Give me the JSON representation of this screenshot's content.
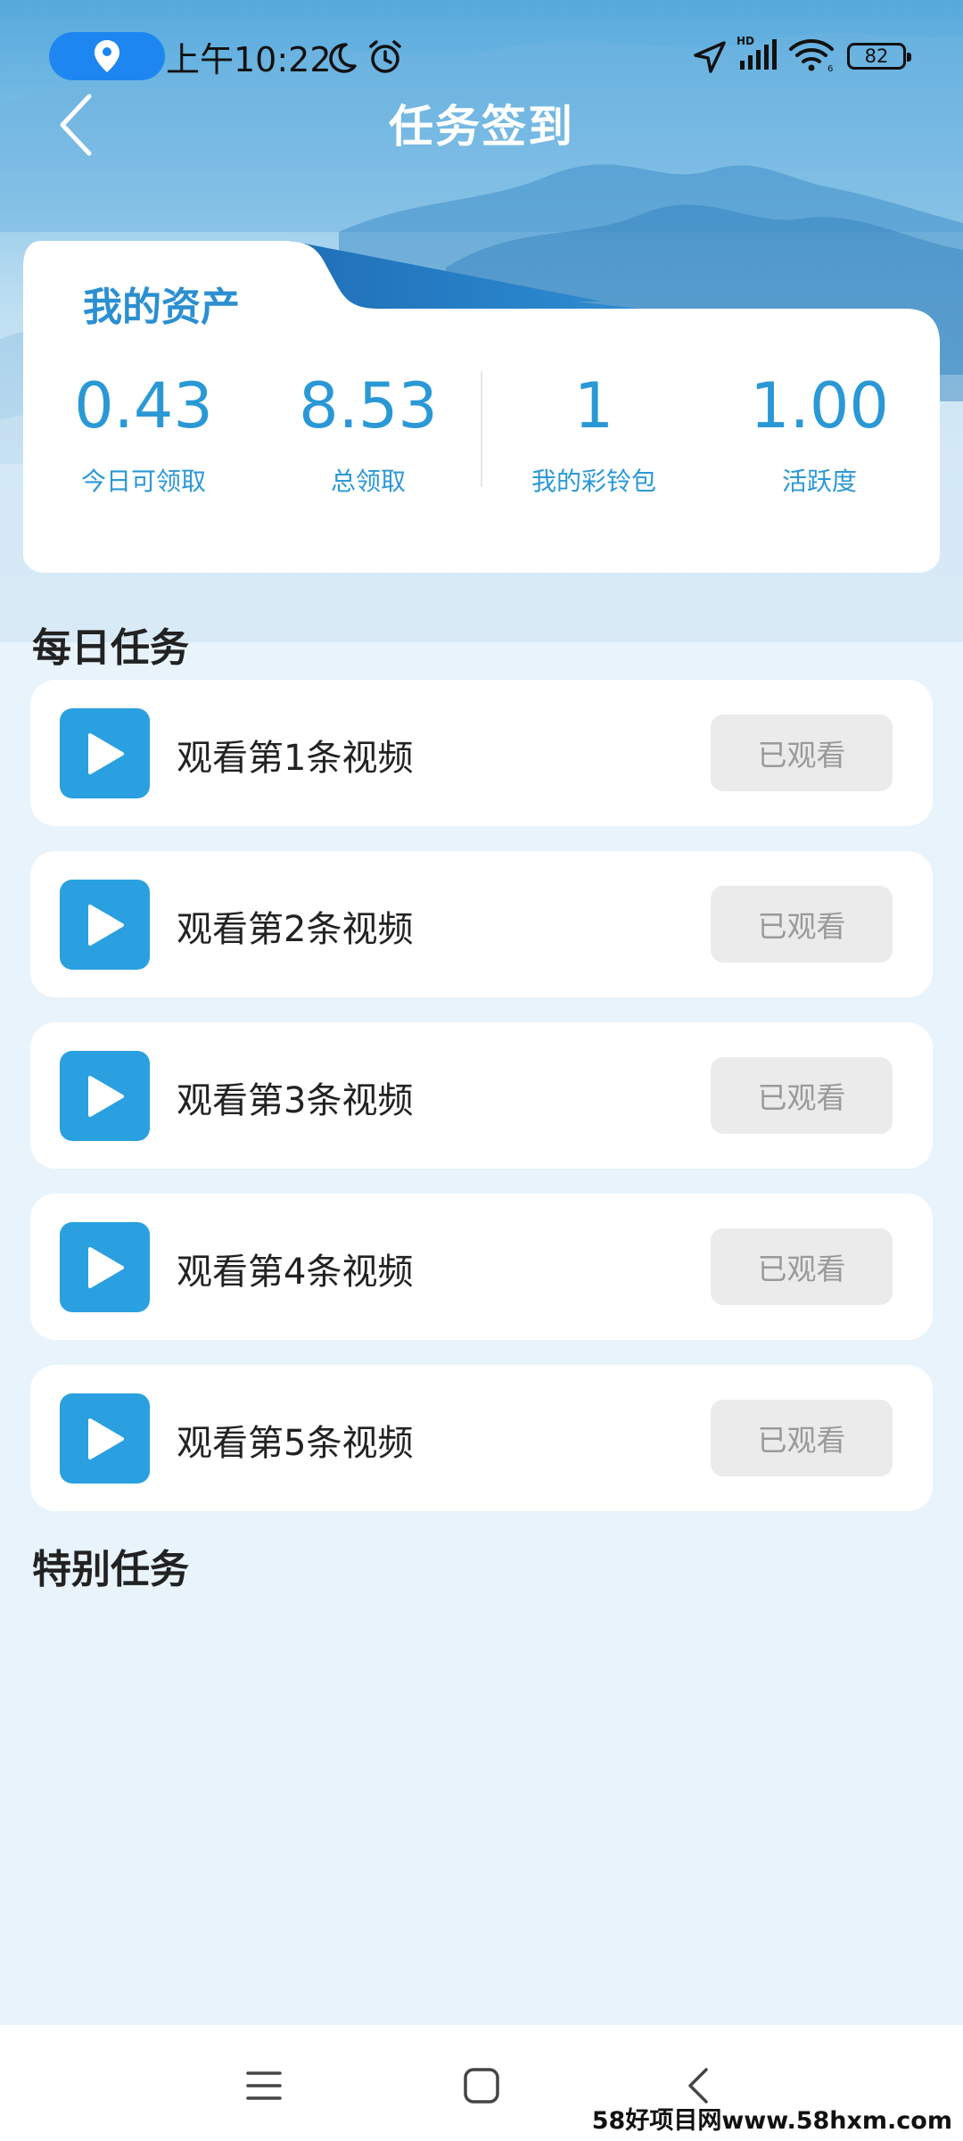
{
  "status_bar": {
    "time": "上午10:22",
    "battery_level": "82",
    "icons": [
      "location-pin-icon",
      "moon-icon",
      "alarm-icon",
      "navigation-arrow-icon",
      "hd-signal-icon",
      "wifi-icon",
      "battery-icon"
    ]
  },
  "header": {
    "title": "任务签到",
    "back_icon": "chevron-left-icon"
  },
  "assets": {
    "title": "我的资产",
    "stats": [
      {
        "value": "0.43",
        "label": "今日可领取"
      },
      {
        "value": "8.53",
        "label": "总领取"
      },
      {
        "value": "1",
        "label": "我的彩铃包"
      },
      {
        "value": "1.00",
        "label": "活跃度"
      }
    ]
  },
  "daily_tasks": {
    "title": "每日任务",
    "items": [
      {
        "label": "观看第1条视频",
        "button": "已观看"
      },
      {
        "label": "观看第2条视频",
        "button": "已观看"
      },
      {
        "label": "观看第3条视频",
        "button": "已观看"
      },
      {
        "label": "观看第4条视频",
        "button": "已观看"
      },
      {
        "label": "观看第5条视频",
        "button": "已观看"
      }
    ]
  },
  "special_tasks": {
    "title": "特别任务"
  },
  "nav_bar": {
    "icons": [
      "menu-icon",
      "home-icon",
      "back-icon"
    ]
  },
  "watermark": "58好项目网www.58hxm.com",
  "colors": {
    "accent": "#2aa0e0",
    "stat_text": "#2b98d6",
    "button_disabled_bg": "#ebebeb",
    "button_disabled_text": "#9a9a9a",
    "page_bg": "#e8f3fb"
  }
}
